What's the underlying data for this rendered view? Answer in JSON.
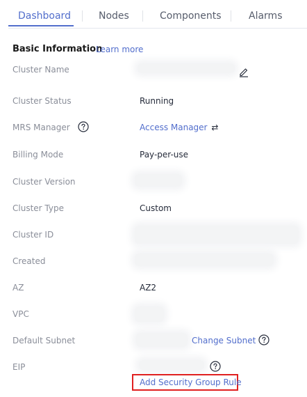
{
  "tabs": {
    "dashboard": "Dashboard",
    "nodes": "Nodes",
    "components": "Components",
    "alarms": "Alarms"
  },
  "section": {
    "title": "Basic Information",
    "learn_more": "Learn more"
  },
  "fields": {
    "cluster_name_label": "Cluster Name",
    "cluster_status_label": "Cluster Status",
    "cluster_status_value": "Running",
    "mrs_manager_label": "MRS Manager",
    "mrs_manager_value": "Access Manager",
    "billing_mode_label": "Billing Mode",
    "billing_mode_value": "Pay-per-use",
    "cluster_version_label": "Cluster Version",
    "cluster_type_label": "Cluster Type",
    "cluster_type_value": "Custom",
    "cluster_id_label": "Cluster ID",
    "created_label": "Created",
    "az_label": "AZ",
    "az_value": "AZ2",
    "vpc_label": "VPC",
    "default_subnet_label": "Default Subnet",
    "change_subnet": "Change Subnet",
    "eip_label": "EIP",
    "add_security_group_rule": "Add Security Group Rule"
  },
  "icons": {
    "switch_glyph": "⇄"
  },
  "colors": {
    "accent": "#526ecc",
    "highlight_box": "#e02020",
    "label": "#8a8e99"
  }
}
